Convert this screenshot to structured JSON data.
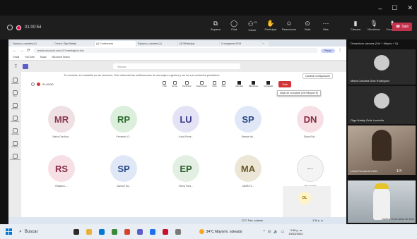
{
  "window": {
    "minimize": "–",
    "maximize": "☐",
    "close": "✕"
  },
  "meeting": {
    "timer": "01:00:54",
    "toolbar": [
      {
        "label": "Separar",
        "icon": "detach-icon"
      },
      {
        "label": "Chat",
        "icon": "chat-icon"
      },
      {
        "label": "Gente",
        "icon": "people-icon",
        "count": "13"
      },
      {
        "label": "Participar",
        "icon": "hand-icon"
      },
      {
        "label": "Reaccionar",
        "icon": "react-icon"
      },
      {
        "label": "Vista",
        "icon": "view-icon"
      },
      {
        "label": "Más",
        "icon": "more-icon"
      },
      {
        "label": "Cámara",
        "icon": "camera-icon"
      },
      {
        "label": "Micrófono",
        "icon": "mic-icon"
      },
      {
        "label": "Compartir",
        "icon": "share-icon"
      }
    ],
    "leave_label": "Salir"
  },
  "browser": {
    "tabs": [
      "Equipos y canales (1)",
      "Correo: Olga Nataly",
      "(4) Conferencia",
      "Equipos y canales (1)",
      "(3) WhatsApp",
      "Cronograma 2024",
      "+"
    ],
    "url": "teams.microsoft.com/v2/?meetingjoin=true",
    "bookmarks": [
      "Gmail",
      "YouTube",
      "Maps",
      "Microsoft Teams"
    ],
    "search_placeholder": "Buscar",
    "notice": "Tu conexión es inestable en las sesiones. Solo obtendrá las notificaciones de mensajes urgentes y los de sus contactos prioritarios.",
    "notice_action": "Cambiar configuración",
    "inner_timer": "01:00:50",
    "inner_toolbar": [
      "Chat",
      "Gente",
      "Participar",
      "Reaccionar",
      "Vista",
      "Más"
    ],
    "inner_controls": [
      "Cámara",
      "Micrófono",
      "Compartir"
    ],
    "inner_leave": "Salir",
    "tooltip": "Dejar de compartir (Ctrl+Mayús+E)",
    "participants": [
      {
        "initials": "MR",
        "name": "María Carolina...",
        "bg": "#efe0e4",
        "fg": "#8a3a52"
      },
      {
        "initials": "RP",
        "name": "Fernando G...",
        "bg": "#dcefdc",
        "fg": "#2e6b2e"
      },
      {
        "initials": "LU",
        "name": "Luisa Ferna...",
        "bg": "#e3e3f5",
        "fg": "#3a3a8a"
      },
      {
        "initials": "SP",
        "name": "Samuel da...",
        "bg": "#e0e8f7",
        "fg": "#2a4a8a"
      },
      {
        "initials": "DN",
        "name": "Diana Ech...",
        "bg": "#f6e0e6",
        "fg": "#8a2a42"
      },
      {
        "initials": "RS",
        "name": "Rafaela L...",
        "bg": "#f6e0e6",
        "fg": "#8a2a42"
      },
      {
        "initials": "SP",
        "name": "Samuel Sa...",
        "bg": "#e0e8f7",
        "fg": "#2a4a8a"
      },
      {
        "initials": "EP",
        "name": "Elena Pard...",
        "bg": "#e3efe3",
        "fg": "#2e5e2e"
      },
      {
        "initials": "MA",
        "name": "MARÍA V...",
        "bg": "#ece6d6",
        "fg": "#6a5a2a"
      },
      {
        "initials": "···",
        "name": "Ver a todos",
        "bg": "#f4f4f4",
        "fg": "#666"
      }
    ],
    "self_initials": "OL",
    "self_name": "Olga Nataly Ortiz Londoño",
    "rail": [
      "Actividad",
      "Chat",
      "Equipos",
      "Calendario",
      "Llamadas",
      "Archivos",
      "Aplicaciones"
    ]
  },
  "right_panel": {
    "hint": "Desactivar cámara (Ctrl + Mayús + O)",
    "tiles": [
      {
        "name": "María Carolina Díaz Rodríguez",
        "type": "avatar"
      },
      {
        "name": "Olga Nataly Ortiz Londoño",
        "type": "avatar"
      },
      {
        "name": "Luisa Fernanda Uribe",
        "type": "video"
      },
      {
        "name": "",
        "type": "video"
      }
    ],
    "pager": "1/4",
    "datetime": "martes, 19 de marzo de 2024"
  },
  "taskbar": {
    "search_placeholder": "Buscar",
    "weather": "34°C Mayorm. soleado",
    "inner_weather": "32°C Parc. soleado",
    "time": "3:38 p. m.",
    "date": "19/03/2024",
    "inner_time": "3:36 p. m.",
    "inner_date": "19/03/2024"
  }
}
